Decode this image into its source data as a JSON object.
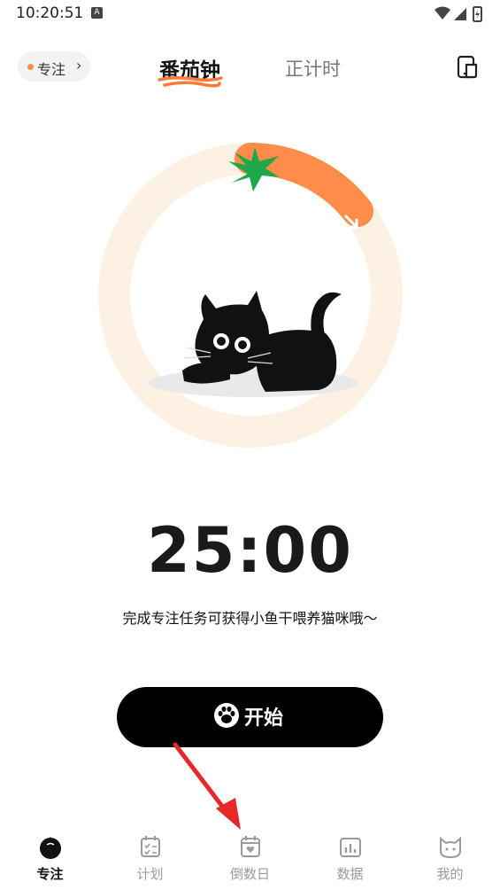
{
  "status": {
    "time": "10:20:51",
    "a_badge": "A"
  },
  "header": {
    "focus_chip": {
      "label": "专注",
      "chevron": "›"
    },
    "tabs": [
      {
        "label": "番茄钟",
        "active": true
      },
      {
        "label": "正计时",
        "active": false
      }
    ],
    "right_icon": "phone-split-icon"
  },
  "main": {
    "illustration": "black-cat",
    "timer": "25:00",
    "hint": "完成专注任务可获得小鱼干喂养猫咪哦～",
    "progress_fraction": 0.17
  },
  "start_button": {
    "label": "开始",
    "icon": "paw-icon"
  },
  "bottom_nav": [
    {
      "label": "专注",
      "icon": "tomato-icon",
      "active": true
    },
    {
      "label": "计划",
      "icon": "plan-calendar-icon",
      "active": false
    },
    {
      "label": "倒数日",
      "icon": "countdown-calendar-icon",
      "active": false
    },
    {
      "label": "数据",
      "icon": "bar-chart-icon",
      "active": false
    },
    {
      "label": "我的",
      "icon": "cat-face-icon",
      "active": false
    }
  ],
  "colors": {
    "accent": "#ff8c4a",
    "ring_bg": "#fdf1e4",
    "leaf": "#1fa84a",
    "annotation_arrow": "#e8272b"
  }
}
